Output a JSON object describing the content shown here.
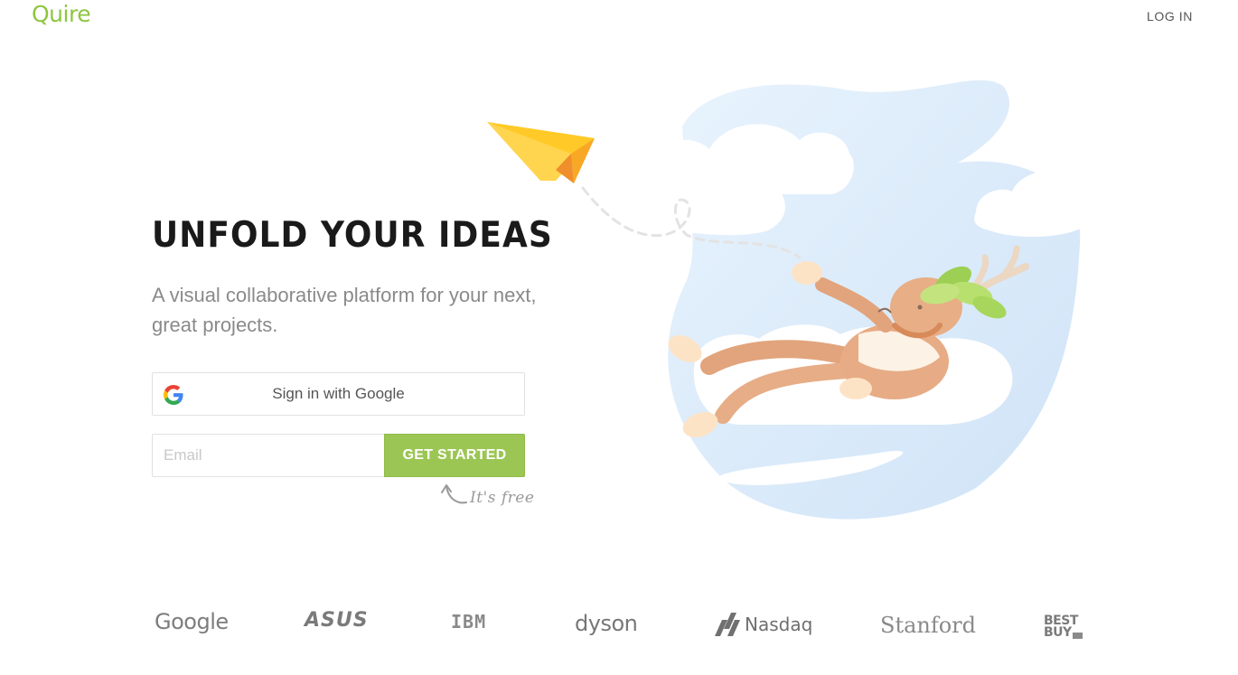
{
  "header": {
    "logo_text": "Quire",
    "login_label": "LOG IN"
  },
  "hero": {
    "title": "UNFOLD YOUR IDEAS",
    "subtitle": "A visual collaborative platform for your next, great projects."
  },
  "signup": {
    "google_button_label": "Sign in with Google",
    "email_placeholder": "Email",
    "email_value": "",
    "get_started_label": "GET STARTED",
    "free_note": "It's free"
  },
  "colors": {
    "brand_green": "#8dc63f",
    "button_green": "#9cc654",
    "title": "#1a1a1a",
    "subtitle": "#8a8a8a"
  },
  "illustration": {
    "description": "Paper plane and moose character reclining on a cloud in a blue sky drop"
  },
  "customers": {
    "logos": [
      "Google",
      "ASUS",
      "IBM",
      "dyson",
      "Nasdaq",
      "Stanford",
      "BEST BUY"
    ]
  }
}
